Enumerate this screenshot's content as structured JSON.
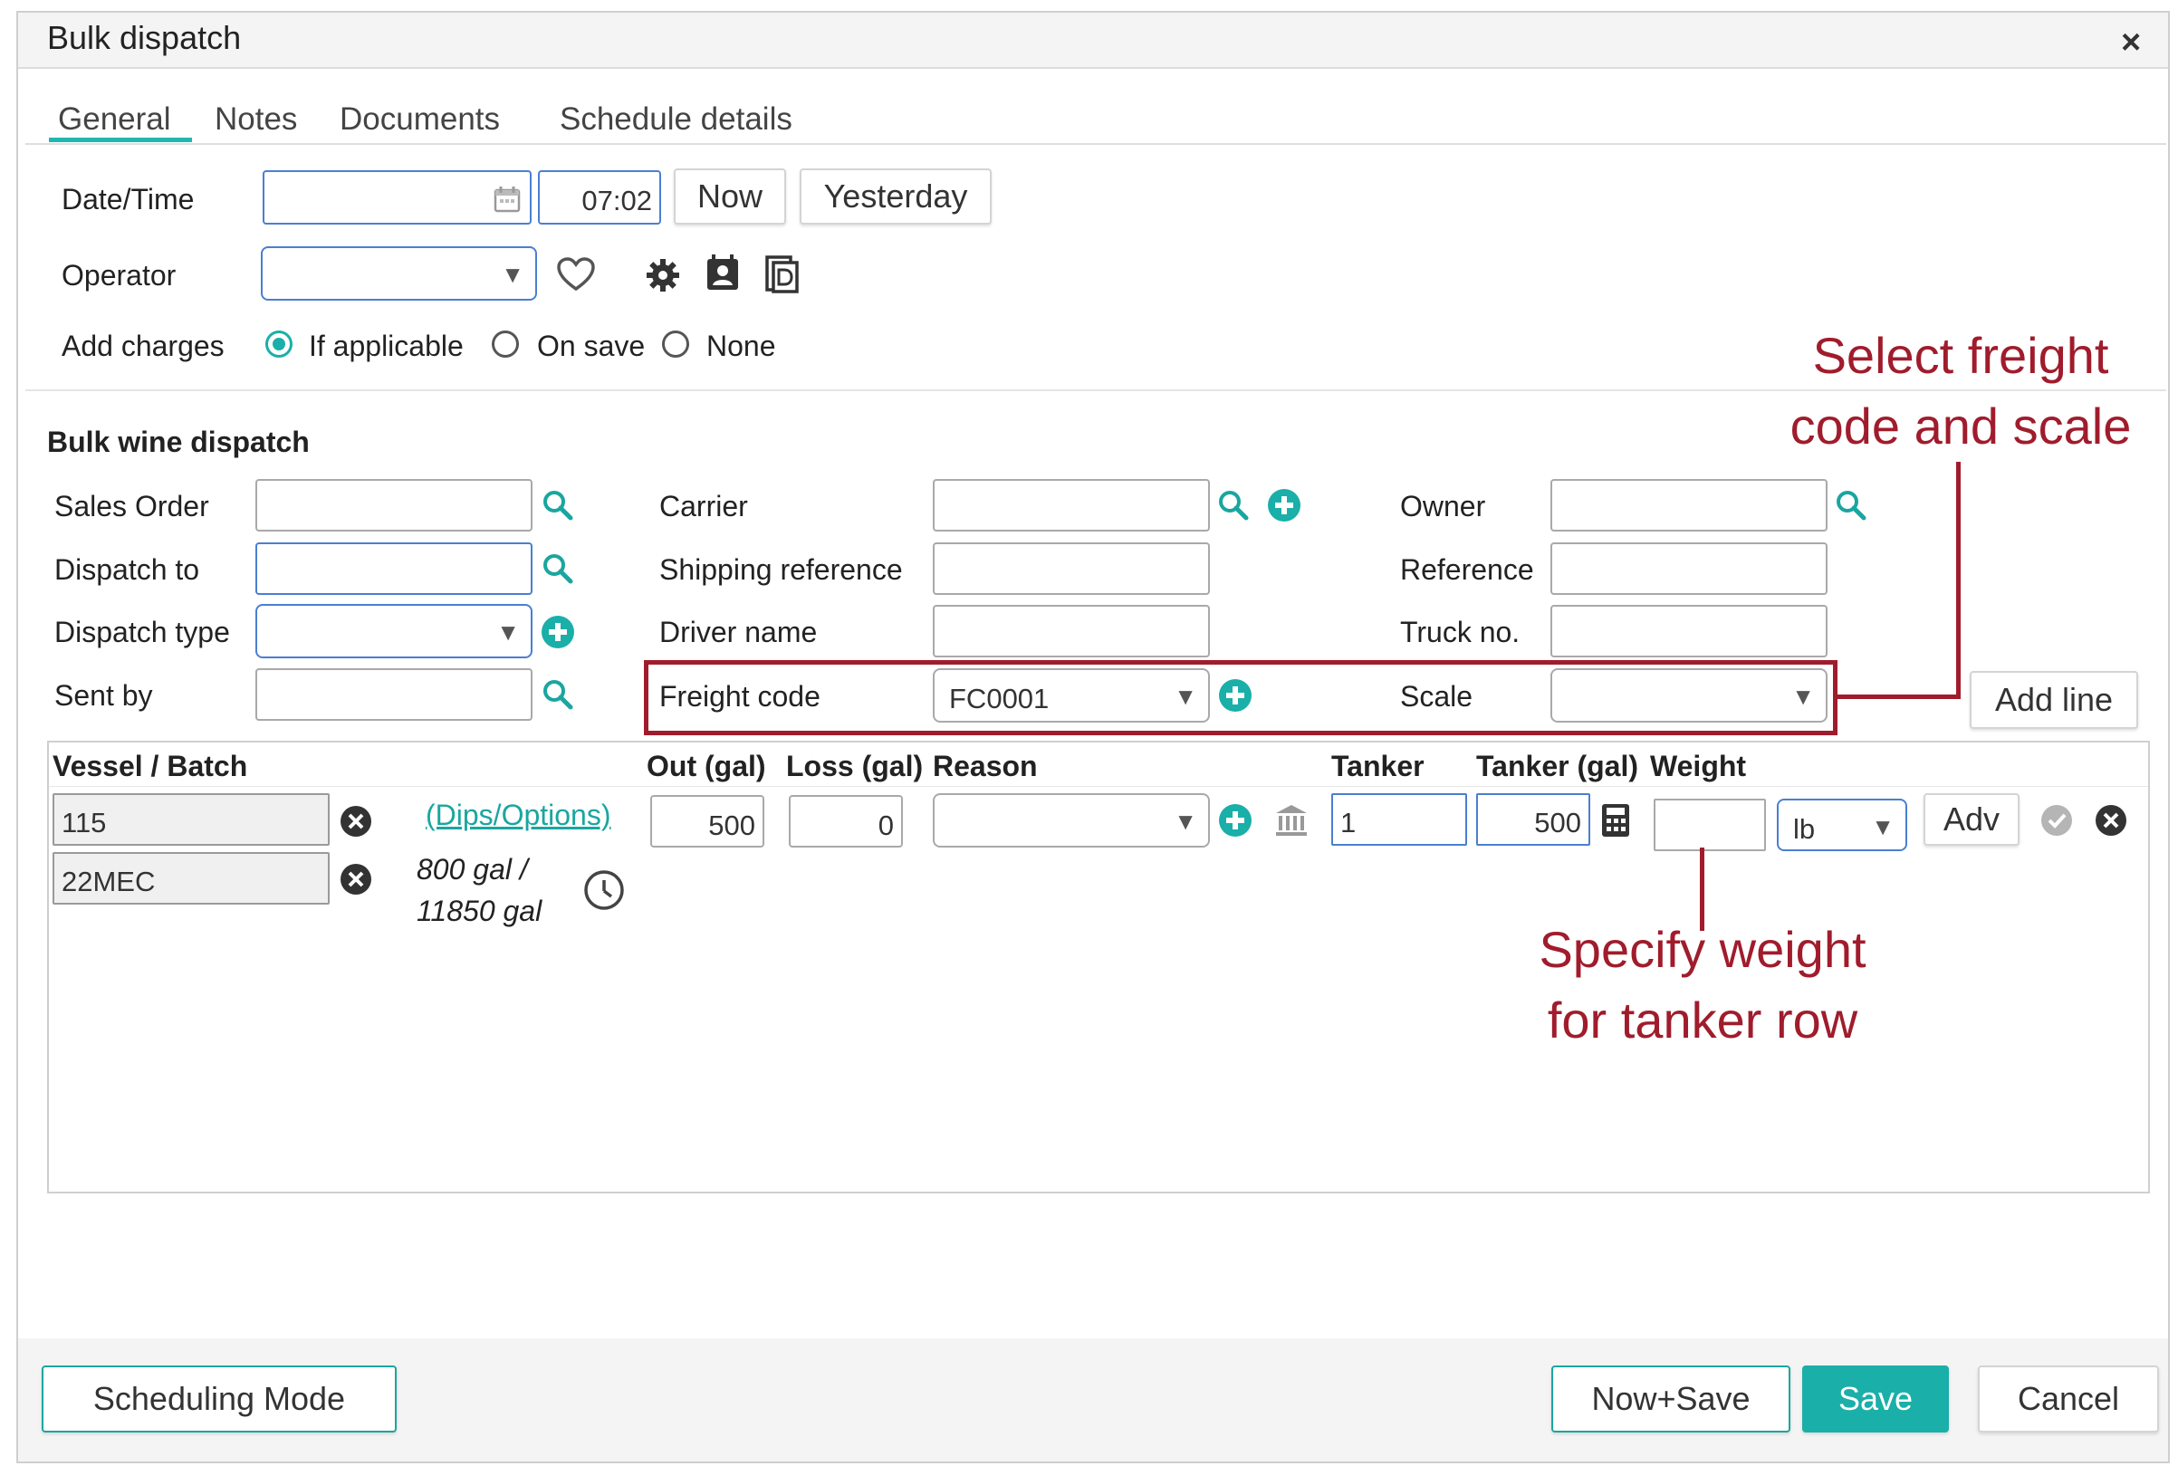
{
  "dialog": {
    "title": "Bulk dispatch",
    "close_symbol": "×"
  },
  "tabs": [
    {
      "label": "General",
      "active": true
    },
    {
      "label": "Notes"
    },
    {
      "label": "Documents"
    },
    {
      "label": "Schedule details"
    }
  ],
  "general": {
    "datetime_label": "Date/Time",
    "date_value": "",
    "time_value": "07:02",
    "now_button": "Now",
    "yesterday_button": "Yesterday",
    "operator_label": "Operator",
    "operator_value": "",
    "add_charges_label": "Add charges",
    "charge_options": [
      "If applicable",
      "On save",
      "None"
    ],
    "charge_selected": "If applicable"
  },
  "bulk": {
    "section_title": "Bulk wine dispatch",
    "sales_order_label": "Sales Order",
    "dispatch_to_label": "Dispatch to",
    "dispatch_type_label": "Dispatch type",
    "sent_by_label": "Sent by",
    "carrier_label": "Carrier",
    "shipping_reference_label": "Shipping reference",
    "driver_name_label": "Driver name",
    "freight_code_label": "Freight code",
    "freight_code_value": "FC0001",
    "owner_label": "Owner",
    "reference_label": "Reference",
    "truck_no_label": "Truck no.",
    "scale_label": "Scale",
    "scale_value": "",
    "add_line_button": "Add line"
  },
  "grid": {
    "headers": {
      "vessel_batch": "Vessel / Batch",
      "out_gal": "Out (gal)",
      "loss_gal": "Loss (gal)",
      "reason": "Reason",
      "tanker": "Tanker",
      "tanker_gal": "Tanker (gal)",
      "weight": "Weight"
    },
    "row": {
      "vessel": "115",
      "batch": "22MEC",
      "dips_link": "(Dips/Options)",
      "volume_line1": "800 gal /",
      "volume_line2": "11850 gal",
      "out": "500",
      "loss": "0",
      "reason": "",
      "tanker": "1",
      "tanker_gal": "500",
      "weight": "",
      "weight_unit": "lb",
      "adv_button": "Adv"
    }
  },
  "footer": {
    "scheduling_mode_button": "Scheduling Mode",
    "now_save_button": "Now+Save",
    "save_button": "Save",
    "cancel_button": "Cancel"
  },
  "annotations": {
    "freight_line1": "Select freight",
    "freight_line2": "code and scale",
    "weight_line1": "Specify weight",
    "weight_line2": "for tanker row"
  },
  "colors": {
    "accent": "#1aafa8",
    "annotation": "#a01c2c",
    "input_focus": "#4a7fd1"
  },
  "icons": [
    "calendar-icon",
    "heart-icon",
    "gear-icon",
    "contact-card-icon",
    "document-icon",
    "search-icon",
    "add-circle-icon",
    "remove-circle-icon",
    "clock-icon",
    "bank-icon",
    "calculator-icon",
    "check-circle-icon",
    "chevron-down-icon"
  ]
}
